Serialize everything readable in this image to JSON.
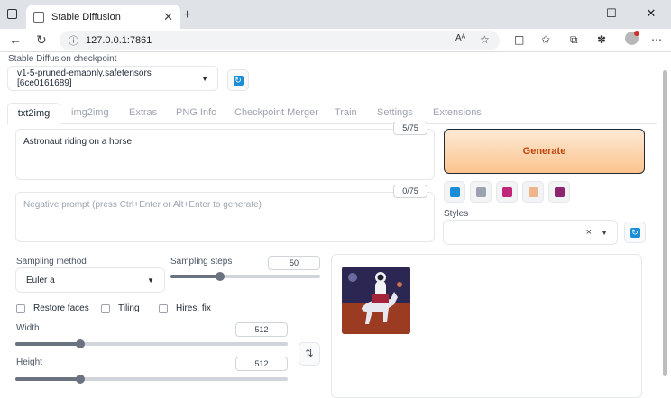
{
  "browser": {
    "tab_title": "Stable Diffusion",
    "tab_close": "✕",
    "new_tab": "+",
    "url": "127.0.0.1:7861",
    "window_buttons": [
      "—",
      "☐",
      "✕"
    ]
  },
  "checkpoint": {
    "label": "Stable Diffusion checkpoint",
    "value": "v1-5-pruned-emaonly.safetensors [6ce0161689]"
  },
  "tabs": [
    {
      "label": "txt2img",
      "active": true
    },
    {
      "label": "img2img"
    },
    {
      "label": "Extras"
    },
    {
      "label": "PNG Info"
    },
    {
      "label": "Checkpoint Merger"
    },
    {
      "label": "Train"
    },
    {
      "label": "Settings"
    },
    {
      "label": "Extensions"
    }
  ],
  "prompt": {
    "value": "Astronaut riding on a horse",
    "counter": "5/75"
  },
  "negative_prompt": {
    "placeholder": "Negative prompt (press Ctrl+Enter or Alt+Enter to generate)",
    "counter": "0/75"
  },
  "generate_label": "Generate",
  "styles": {
    "label": "Styles",
    "clear": "×"
  },
  "sampling_method": {
    "label": "Sampling method",
    "value": "Euler a"
  },
  "sampling_steps": {
    "label": "Sampling steps",
    "value": "50",
    "fraction": 0.33
  },
  "checkboxes": {
    "restore_faces": "Restore faces",
    "tiling": "Tiling",
    "hires_fix": "Hires. fix"
  },
  "width": {
    "label": "Width",
    "value": "512",
    "fraction": 0.24
  },
  "height": {
    "label": "Height",
    "value": "512",
    "fraction": 0.24
  },
  "swap_label": "⇅",
  "colors": {
    "accent_orange": "#c2410c",
    "refresh_blue": "#1a8cd8"
  }
}
